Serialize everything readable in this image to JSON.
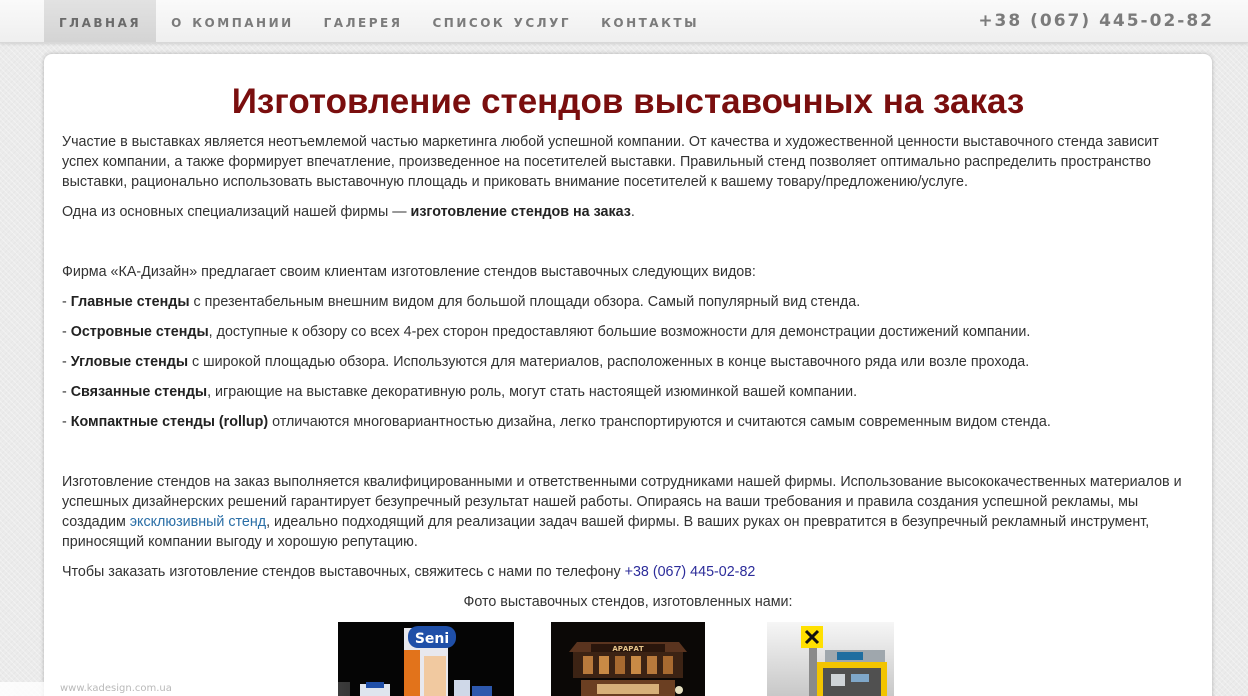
{
  "nav": {
    "items": [
      {
        "label": "ГЛАВНАЯ"
      },
      {
        "label": "О КОМПАНИИ"
      },
      {
        "label": "ГАЛЕРЕЯ"
      },
      {
        "label": "СПИСОК УСЛУГ"
      },
      {
        "label": "КОНТАКТЫ"
      }
    ],
    "phone": "+38 (067) 445-02-82"
  },
  "main": {
    "title": "Изготовление стендов выставочных на заказ",
    "intro": "Участие в выставках является неотъемлемой частью маркетинга любой успешной компании. От качества и художественной ценности выставочного стенда зависит успех компании, а также формирует впечатление, произведенное на посетителей выставки. Правильный стенд позволяет оптимально распределить пространство выставки, рационально использовать выставочную площадь и приковать внимание посетителей к вашему товару/предложению/услуге.",
    "spec_prefix": "Одна из основных специализаций нашей фирмы — ",
    "spec_bold": "изготовление стендов на заказ",
    "spec_suffix": ".",
    "types_intro": "Фирма «КА-Дизайн» предлагает своим клиентам изготовление стендов выставочных следующих видов:",
    "types": [
      {
        "prefix": "- ",
        "bold": "Главные стенды",
        "text": " с презентабельным внешним видом для большой площади обзора. Самый популярный вид стенда."
      },
      {
        "prefix": "- ",
        "bold": "Островные стенды",
        "text": ", доступные к обзору со всех 4-рех сторон предоставляют большие возможности для демонстрации достижений компании."
      },
      {
        "prefix": "- ",
        "bold": "Угловые стенды",
        "text": " с широкой площадью обзора.  Используются для материалов, расположенных в конце выставочного ряда или возле прохода."
      },
      {
        "prefix": "- ",
        "bold": "Связанные стенды",
        "text": ", играющие на выставке декоративную роль, могут стать настоящей изюминкой вашей компании."
      },
      {
        "prefix": "- ",
        "bold": "Компактные стенды (rollup)",
        "text": " отличаются многовариантностью дизайна, легко транспортируются и считаются самым современным видом стенда."
      }
    ],
    "quality_part1": "Изготовление стендов на заказ выполняется квалифицированными и ответственными сотрудниками нашей фирмы. Использование высококачественных материалов и успешных дизайнерских решений гарантирует безупречный результат нашей работы. Опираясь на ваши  требования и правила создания успешной рекламы, мы создадим ",
    "quality_link": "эксклюзивный стенд",
    "quality_part2": ", идеально подходящий для реализации задач вашей фирмы. В ваших руках он превратится в безупречный рекламный инструмент, приносящий компании выгоду и хорошую репутацию.",
    "order_text": "Чтобы заказать изготовление стендов выставочных, свяжитесь с нами по телефону  ",
    "order_phone": "+38 (067) 445-02-82",
    "photos_caption": "Фото выставочных стендов, изготовленных нами:",
    "photo1_brand": "Seni",
    "photo2_brand": "АРАРАТ"
  },
  "watermark": "www.kadesign.com.ua",
  "colors": {
    "title": "#7a0e0e",
    "link": "#2a6ea6",
    "nav_text": "#7b7b7b"
  }
}
